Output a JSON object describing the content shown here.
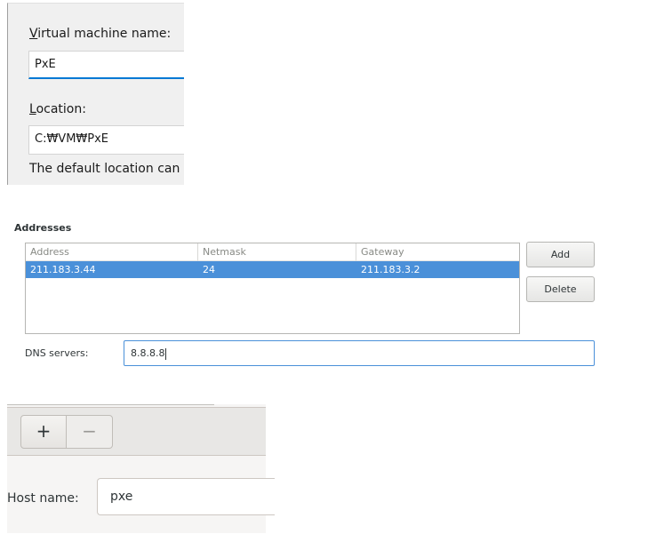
{
  "vm": {
    "name_label_accesskey": "V",
    "name_label_rest": "irtual machine name:",
    "name_value": "PxE",
    "location_label_accesskey": "L",
    "location_label_rest": "ocation:",
    "location_value": "C:₩VM₩PxE",
    "default_location_text": "The default location can"
  },
  "addresses": {
    "title": "Addresses",
    "columns": [
      "Address",
      "Netmask",
      "Gateway"
    ],
    "rows": [
      {
        "address": "211.183.3.44",
        "netmask": "24",
        "gateway": "211.183.3.2",
        "selected": true
      }
    ],
    "add_label": "Add",
    "delete_label": "Delete",
    "dns_label": "DNS servers:",
    "dns_value": "8.8.8.8"
  },
  "host": {
    "plus_label": "+",
    "minus_label": "−",
    "host_label": "Host name:",
    "host_value": "pxe"
  },
  "colors": {
    "selection": "#4a90d9",
    "focus_underline": "#0078d4"
  }
}
